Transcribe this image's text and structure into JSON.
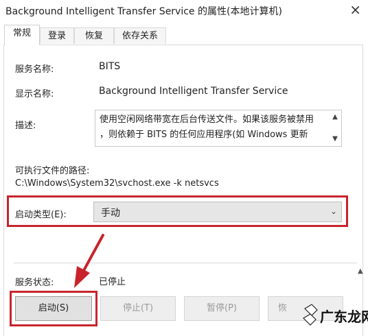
{
  "window": {
    "title": "Background Intelligent Transfer Service 的属性(本地计算机)",
    "close_glyph": "×"
  },
  "tabs": [
    {
      "label": "常规",
      "active": true
    },
    {
      "label": "登录",
      "active": false
    },
    {
      "label": "恢复",
      "active": false
    },
    {
      "label": "依存关系",
      "active": false
    }
  ],
  "general": {
    "service_name_label": "服务名称:",
    "service_name": "BITS",
    "display_name_label": "显示名称:",
    "display_name": "Background Intelligent Transfer Service",
    "description_label": "描述:",
    "description_line1": "使用空闲网络带宽在后台传送文件。如果该服务被禁用",
    "description_line2": "，则依赖于 BITS 的任何应用程序(如 Windows 更新",
    "path_label": "可执行文件的路径:",
    "path": "C:\\Windows\\System32\\svchost.exe -k netsvcs",
    "startup_type_label": "启动类型(E):",
    "startup_type_value": "手动",
    "status_label": "服务状态:",
    "status_value": "已停止"
  },
  "buttons": {
    "start": "启动(S)",
    "stop": "停止(T)",
    "pause": "暂停(P)",
    "resume": "恢"
  },
  "watermark": {
    "text": "广东龙网"
  },
  "colors": {
    "highlight": "#c8232c"
  },
  "icons": {
    "scroll_up": "scroll-up-icon",
    "scroll_down": "scroll-down-icon",
    "dropdown": "chevron-down-icon"
  }
}
